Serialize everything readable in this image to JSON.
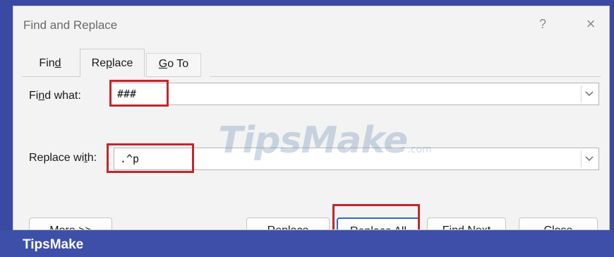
{
  "dialog": {
    "title": "Find and Replace",
    "help_label": "?",
    "close_label": "×"
  },
  "tabs": [
    {
      "label_pre": "Fin",
      "label_key": "d",
      "label_post": ""
    },
    {
      "label_pre": "Re",
      "label_key": "p",
      "label_post": "lace"
    },
    {
      "label_pre": "",
      "label_key": "G",
      "label_post": "o To"
    }
  ],
  "find": {
    "label_pre": "Fi",
    "label_key": "n",
    "label_post": "d what:",
    "value": "###"
  },
  "replace": {
    "label_pre": "Replace wi",
    "label_key": "t",
    "label_post": "h:",
    "value": ".^p"
  },
  "buttons": {
    "more": "More >>",
    "replace": "Replace",
    "replace_all": "Replace All",
    "find_next": "Find Next",
    "close": "Close"
  },
  "watermark": {
    "main": "TipsMake",
    "suffix": ".com"
  },
  "footer": {
    "brand": "TipsMake"
  },
  "colors": {
    "highlight": "#c1272d",
    "footer": "#3d4fa8"
  }
}
